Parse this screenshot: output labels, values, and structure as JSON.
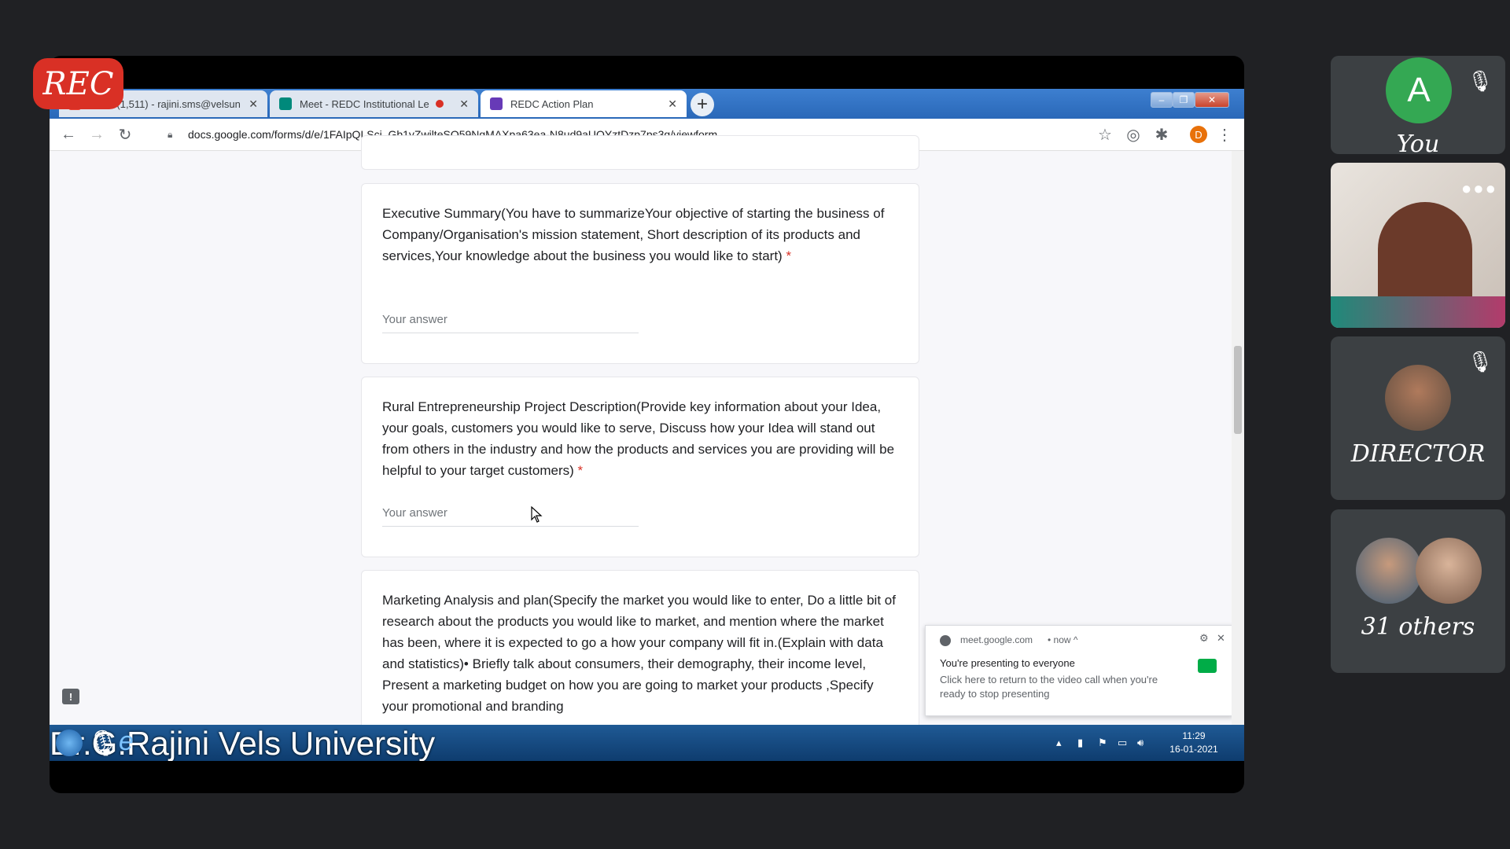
{
  "rec_label": "REC",
  "browser": {
    "tabs": [
      {
        "label": "Inbox (1,511) - rajini.sms@velsun",
        "icon": "gmail-icon"
      },
      {
        "label": "Meet - REDC Institutional Le",
        "icon": "meet-icon"
      },
      {
        "label": "REDC Action Plan",
        "icon": "forms-icon",
        "active": true
      }
    ],
    "url": "docs.google.com/forms/d/e/1FAIpQLScj_Gb1yZwjlteSQ59NgMAXpa63ea-N8ud9aUQYztDzp7ps3g/viewform",
    "profile_initial": "D"
  },
  "form": {
    "questions": [
      {
        "text": "Executive Summary(You have to summarizeYour objective of starting the business of Company/Organisation's mission statement, Short description of its products and services,Your knowledge about the business you would like to start)",
        "required": "*",
        "answer_placeholder": "Your answer"
      },
      {
        "text": "Rural Entrepreneurship Project Description(Provide key information about your Idea, your goals, customers you would like to serve, Discuss how your Idea will stand out from others in the industry and how the products and services you are providing will be helpful to your target customers)",
        "required": "*",
        "answer_placeholder": "Your answer"
      },
      {
        "text": "Marketing Analysis and plan(Specify the market you would like to enter, Do a little bit of research about the products you would like to market, and mention where the market has been, where it is expected to go a how your company will fit in.(Explain with data and statistics)• Briefly talk about consumers, their demography, their income level, Present a marketing budget on how you are going to market your products ,Specify your promotional and branding"
      }
    ]
  },
  "notification": {
    "source": "meet.google.com",
    "time": "• now ^",
    "title": "You're presenting to everyone",
    "body": "Click here to return to the video call when you're ready to stop presenting"
  },
  "taskbar": {
    "presenter_name": "Dr.G.Rajini Vels University",
    "time": "11:29",
    "date": "16-01-2021"
  },
  "participants": [
    {
      "name": "You",
      "initial": "A"
    },
    {
      "name": ""
    },
    {
      "name": "DIRECTOR"
    },
    {
      "name": "31 others"
    }
  ]
}
